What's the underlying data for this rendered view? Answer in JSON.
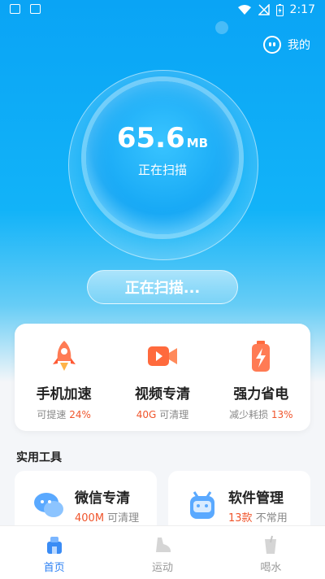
{
  "status": {
    "time": "2:17"
  },
  "header": {
    "mine_label": "我的"
  },
  "scan": {
    "size_value": "65.6",
    "size_unit": "MB",
    "status_label": "正在扫描",
    "button_label": "正在扫描..."
  },
  "features": [
    {
      "title": "手机加速",
      "desc": "可提速",
      "highlight": "24%",
      "icon": "rocket-icon",
      "highlight_first": false
    },
    {
      "title": "视频专清",
      "desc": "可清理",
      "highlight": "40G",
      "icon": "video-icon",
      "highlight_first": true
    },
    {
      "title": "强力省电",
      "desc": "减少耗损",
      "highlight": "13%",
      "icon": "battery-icon",
      "highlight_first": false
    }
  ],
  "tools": {
    "title": "实用工具",
    "items": [
      {
        "title": "微信专清",
        "highlight": "400M",
        "desc": "可清理",
        "icon": "wechat-icon"
      },
      {
        "title": "软件管理",
        "highlight": "13款",
        "desc": "不常用",
        "icon": "android-icon"
      }
    ]
  },
  "tabs": [
    {
      "label": "首页",
      "icon": "home-icon",
      "active": true
    },
    {
      "label": "运动",
      "icon": "shoe-icon",
      "active": false
    },
    {
      "label": "喝水",
      "icon": "cup-icon",
      "active": false
    }
  ],
  "colors": {
    "primary": "#0aa4f5",
    "highlight": "#f0552c",
    "tab_active": "#2a7ff3"
  }
}
